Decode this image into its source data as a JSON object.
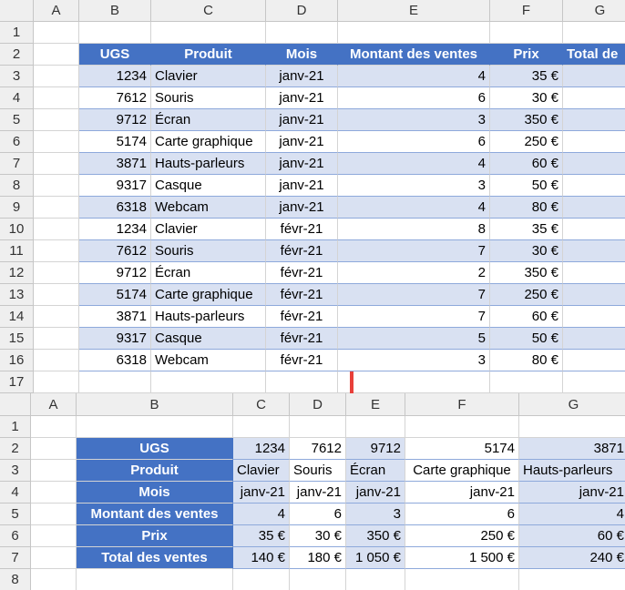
{
  "top": {
    "col_letters": [
      "A",
      "B",
      "C",
      "D",
      "E",
      "F",
      "G"
    ],
    "row_numbers": [
      "1",
      "2",
      "3",
      "4",
      "5",
      "6",
      "7",
      "8",
      "9",
      "10",
      "11",
      "12",
      "13",
      "14",
      "15",
      "16",
      "17"
    ],
    "headers": [
      "UGS",
      "Produit",
      "Mois",
      "Montant des ventes",
      "Prix",
      "Total de"
    ],
    "rows": [
      [
        "1234",
        "Clavier",
        "janv-21",
        "4",
        "35 €"
      ],
      [
        "7612",
        "Souris",
        "janv-21",
        "6",
        "30 €"
      ],
      [
        "9712",
        "Écran",
        "janv-21",
        "3",
        "350 €"
      ],
      [
        "5174",
        "Carte graphique",
        "janv-21",
        "6",
        "250 €"
      ],
      [
        "3871",
        "Hauts-parleurs",
        "janv-21",
        "4",
        "60 €"
      ],
      [
        "9317",
        "Casque",
        "janv-21",
        "3",
        "50 €"
      ],
      [
        "6318",
        "Webcam",
        "janv-21",
        "4",
        "80 €"
      ],
      [
        "1234",
        "Clavier",
        "févr-21",
        "8",
        "35 €"
      ],
      [
        "7612",
        "Souris",
        "févr-21",
        "7",
        "30 €"
      ],
      [
        "9712",
        "Écran",
        "févr-21",
        "2",
        "350 €"
      ],
      [
        "5174",
        "Carte graphique",
        "févr-21",
        "7",
        "250 €"
      ],
      [
        "3871",
        "Hauts-parleurs",
        "févr-21",
        "7",
        "60 €"
      ],
      [
        "9317",
        "Casque",
        "févr-21",
        "5",
        "50 €"
      ],
      [
        "6318",
        "Webcam",
        "févr-21",
        "3",
        "80 €"
      ]
    ]
  },
  "bottom": {
    "col_letters": [
      "A",
      "B",
      "C",
      "D",
      "E",
      "F",
      "G"
    ],
    "row_numbers": [
      "1",
      "2",
      "3",
      "4",
      "5",
      "6",
      "7",
      "8"
    ],
    "labels": [
      "UGS",
      "Produit",
      "Mois",
      "Montant des ventes",
      "Prix",
      "Total des ventes"
    ],
    "columns": [
      [
        "1234",
        "Clavier",
        "janv-21",
        "4",
        "35 €",
        "140 €"
      ],
      [
        "7612",
        "Souris",
        "janv-21",
        "6",
        "30 €",
        "180 €"
      ],
      [
        "9712",
        "Écran",
        "janv-21",
        "3",
        "350 €",
        "1 050 €"
      ],
      [
        "5174",
        "Carte graphique",
        "janv-21",
        "6",
        "250 €",
        "1 500 €"
      ],
      [
        "3871",
        "Hauts-parleurs",
        "janv-21",
        "4",
        "60 €",
        "240 €"
      ]
    ]
  },
  "colors": {
    "header_blue": "#4472c4",
    "band_blue": "#d9e1f2",
    "arrow_red": "#e8403a"
  }
}
